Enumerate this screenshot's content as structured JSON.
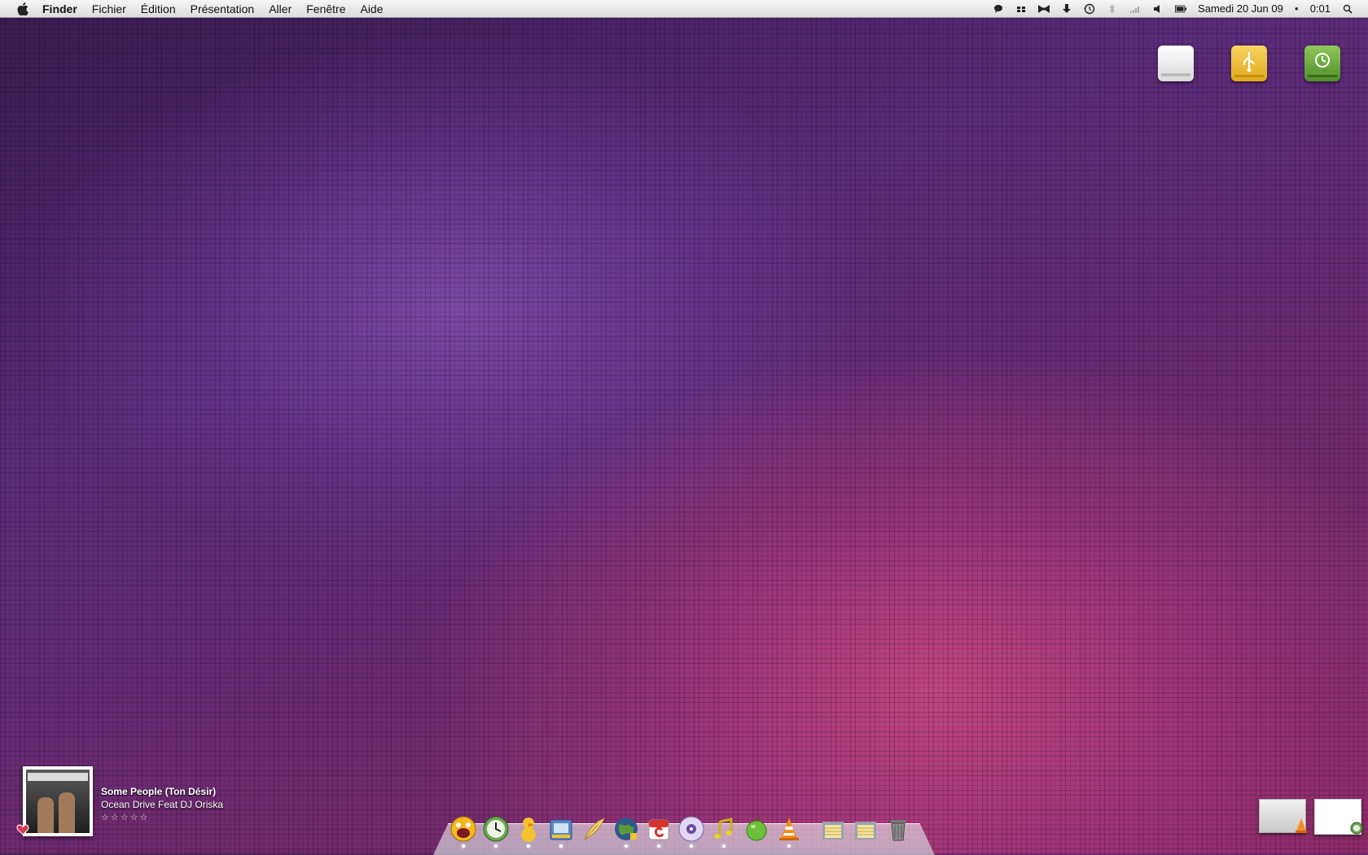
{
  "menubar": {
    "apple_icon": "apple-logo-icon",
    "app_name": "Finder",
    "menus": [
      "Fichier",
      "Édition",
      "Présentation",
      "Aller",
      "Fenêtre",
      "Aide"
    ],
    "status_icons": [
      "chat-icon",
      "spaces-icon",
      "bowtie-icon",
      "download-icon",
      "time-machine-icon",
      "bluetooth-icon",
      "wifi-icon",
      "volume-icon",
      "battery-icon"
    ],
    "clock": "Samedi 20 Jun 09",
    "time": "0:01",
    "spotlight_icon": "spotlight-search-icon"
  },
  "desktop": {
    "drives": [
      "hard-drive-icon",
      "usb-drive-icon",
      "time-machine-drive-icon"
    ]
  },
  "now_playing": {
    "title": "Some People (Ton Désir)",
    "artist": "Ocean Drive Feat DJ Oriska",
    "rating_text": "☆☆☆☆☆",
    "rating": 0
  },
  "dock": {
    "items": [
      "adium-icon",
      "clock-icon",
      "cyberduck-icon",
      "preview-icon",
      "feather-icon",
      "globe-icon",
      "calendar-icon",
      "itunes-icon",
      "music-notes-icon",
      "apple-icon",
      "vlc-icon",
      "documents-stack-icon",
      "downloads-stack-icon",
      "trash-icon"
    ]
  },
  "colors": {
    "menubar_bg": "#e6e6e6",
    "desktop_purple": "#5a2c7a",
    "desktop_pink": "#c0457f"
  }
}
